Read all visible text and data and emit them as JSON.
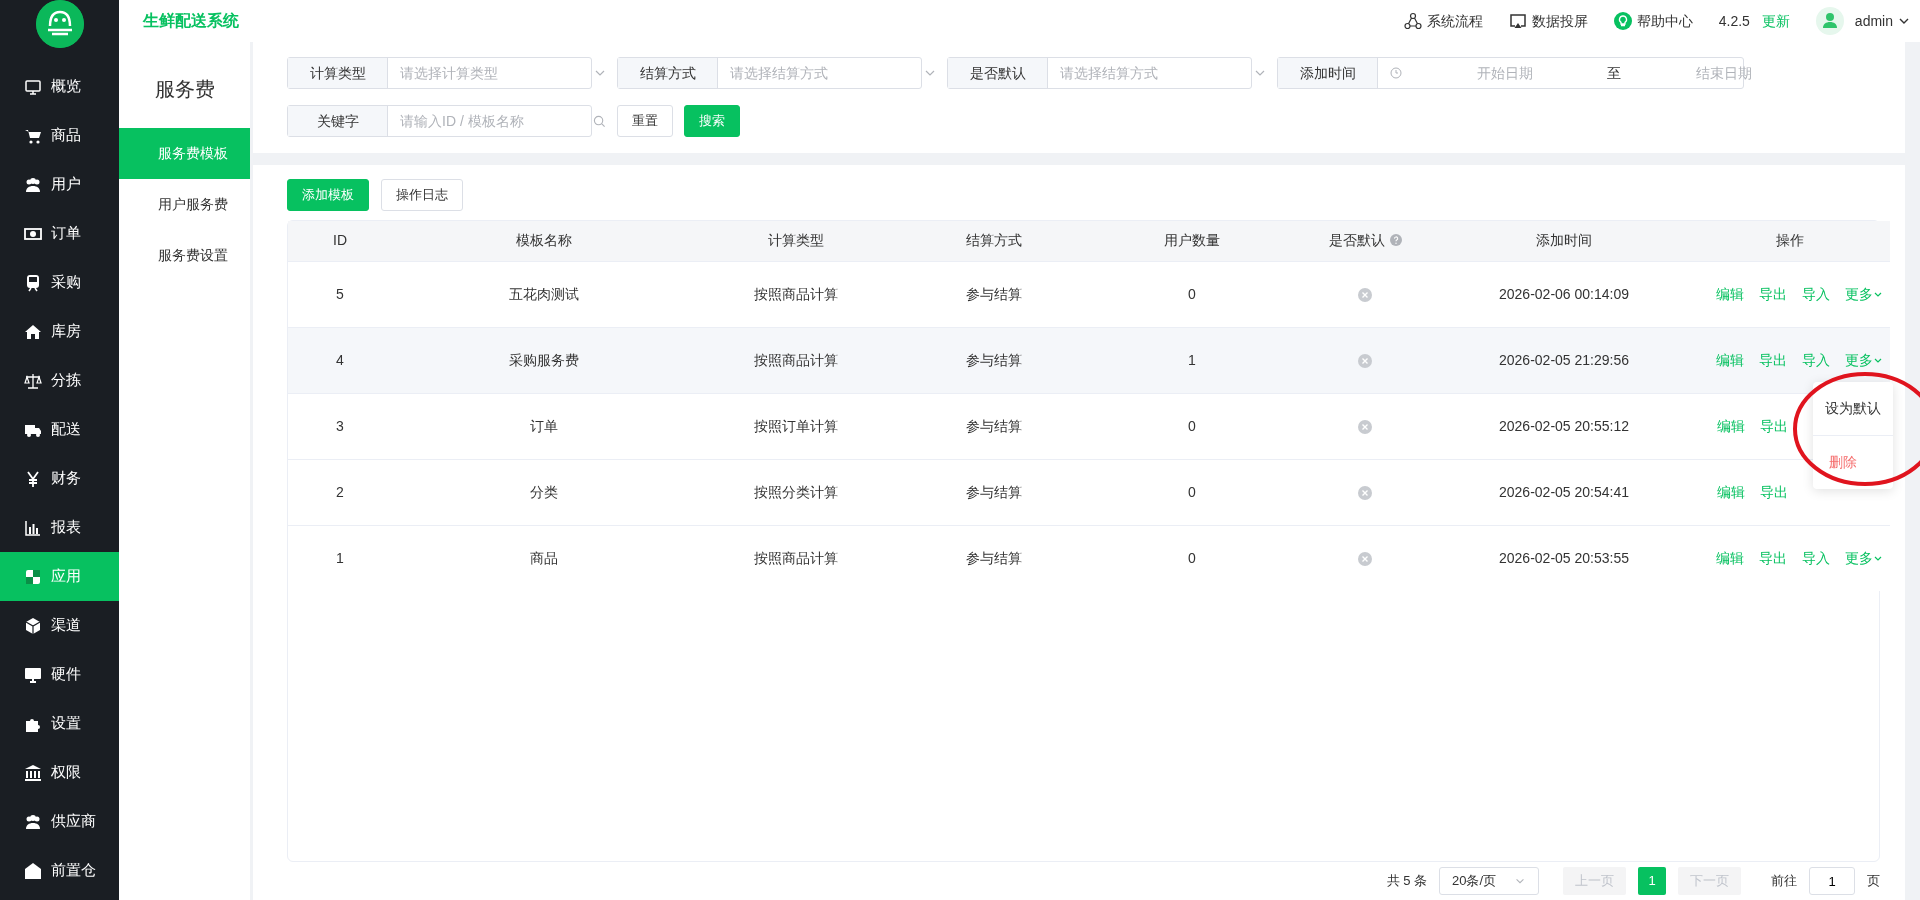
{
  "app": {
    "title": "生鲜配送系统"
  },
  "sidebar": {
    "items": [
      {
        "label": "概览",
        "selected": false
      },
      {
        "label": "商品",
        "selected": false
      },
      {
        "label": "用户",
        "selected": false
      },
      {
        "label": "订单",
        "selected": false
      },
      {
        "label": "采购",
        "selected": false
      },
      {
        "label": "库房",
        "selected": false
      },
      {
        "label": "分拣",
        "selected": false
      },
      {
        "label": "配送",
        "selected": false
      },
      {
        "label": "财务",
        "selected": false
      },
      {
        "label": "报表",
        "selected": false
      },
      {
        "label": "应用",
        "selected": true
      },
      {
        "label": "渠道",
        "selected": false
      },
      {
        "label": "硬件",
        "selected": false
      },
      {
        "label": "设置",
        "selected": false
      },
      {
        "label": "权限",
        "selected": false
      },
      {
        "label": "供应商",
        "selected": false
      },
      {
        "label": "前置仓",
        "selected": false
      }
    ]
  },
  "header": {
    "links": [
      "系统流程",
      "数据投屏",
      "帮助中心"
    ],
    "version": "4.2.5",
    "update": "更新",
    "user": "admin"
  },
  "subnav": {
    "title": "服务费",
    "items": [
      {
        "label": "服务费模板",
        "selected": true
      },
      {
        "label": "用户服务费",
        "selected": false
      },
      {
        "label": "服务费设置",
        "selected": false
      }
    ]
  },
  "filters": [
    {
      "kind": "select",
      "label": "计算类型",
      "placeholder": "请选择计算类型"
    },
    {
      "kind": "select",
      "label": "结算方式",
      "placeholder": "请选择结算方式"
    },
    {
      "kind": "select",
      "label": "是否默认",
      "placeholder": "请选择结算方式"
    },
    {
      "kind": "daterange",
      "label": "添加时间",
      "start_placeholder": "开始日期",
      "separator": "至",
      "end_placeholder": "结束日期"
    },
    {
      "kind": "search",
      "label": "关键字",
      "placeholder": "请输入ID / 模板名称"
    }
  ],
  "filter_buttons": [
    {
      "label": "重置",
      "kind": "plain"
    },
    {
      "label": "搜索",
      "kind": "primary"
    }
  ],
  "toolbar": [
    {
      "label": "添加模板",
      "kind": "primary"
    },
    {
      "label": "操作日志",
      "kind": "plain"
    }
  ],
  "table": {
    "columns": [
      {
        "label": "ID",
        "help": false
      },
      {
        "label": "模板名称",
        "help": false
      },
      {
        "label": "计算类型",
        "help": false
      },
      {
        "label": "结算方式",
        "help": false
      },
      {
        "label": "用户数量",
        "help": false
      },
      {
        "label": "是否默认",
        "help": true
      },
      {
        "label": "添加时间",
        "help": false
      },
      {
        "label": "操作",
        "help": false
      }
    ],
    "rows": [
      {
        "id": "5",
        "name": "五花肉测试",
        "calc": "按照商品计算",
        "settle": "参与结算",
        "users": "0",
        "is_default": false,
        "time": "2026-02-06 00:14:09",
        "highlighted": false,
        "actions": [
          {
            "label": "编辑",
            "has_menu": false
          },
          {
            "label": "导出",
            "has_menu": false
          },
          {
            "label": "导入",
            "has_menu": false
          },
          {
            "label": "更多",
            "has_menu": true
          }
        ]
      },
      {
        "id": "4",
        "name": "采购服务费",
        "calc": "按照商品计算",
        "settle": "参与结算",
        "users": "1",
        "is_default": false,
        "time": "2026-02-05 21:29:56",
        "highlighted": true,
        "actions": [
          {
            "label": "编辑",
            "has_menu": false
          },
          {
            "label": "导出",
            "has_menu": false
          },
          {
            "label": "导入",
            "has_menu": false
          },
          {
            "label": "更多",
            "has_menu": true,
            "menu": [
              {
                "label": "设为默认",
                "kind": "normal"
              },
              {
                "label": "删除",
                "kind": "danger"
              }
            ]
          }
        ]
      },
      {
        "id": "3",
        "name": "订单",
        "calc": "按照订单计算",
        "settle": "参与结算",
        "users": "0",
        "is_default": false,
        "time": "2026-02-05 20:55:12",
        "highlighted": false,
        "actions": [
          {
            "label": "编辑",
            "has_menu": false
          },
          {
            "label": "导出",
            "has_menu": false
          }
        ]
      },
      {
        "id": "2",
        "name": "分类",
        "calc": "按照分类计算",
        "settle": "参与结算",
        "users": "0",
        "is_default": false,
        "time": "2026-02-05 20:54:41",
        "highlighted": false,
        "actions": [
          {
            "label": "编辑",
            "has_menu": false
          },
          {
            "label": "导出",
            "has_menu": false
          }
        ]
      },
      {
        "id": "1",
        "name": "商品",
        "calc": "按照商品计算",
        "settle": "参与结算",
        "users": "0",
        "is_default": false,
        "time": "2026-02-05 20:53:55",
        "highlighted": false,
        "actions": [
          {
            "label": "编辑",
            "has_menu": false
          },
          {
            "label": "导出",
            "has_menu": false
          },
          {
            "label": "导入",
            "has_menu": false
          },
          {
            "label": "更多",
            "has_menu": true
          }
        ]
      }
    ]
  },
  "pagination": {
    "total": "共 5 条",
    "page_size": "20条/页",
    "prev": "上一页",
    "pages": [
      {
        "label": "1",
        "selected": true
      }
    ],
    "next": "下一页",
    "prev_disabled": true,
    "next_disabled": true,
    "goto_label": "前往",
    "goto_value": "1",
    "goto_suffix": "页"
  }
}
